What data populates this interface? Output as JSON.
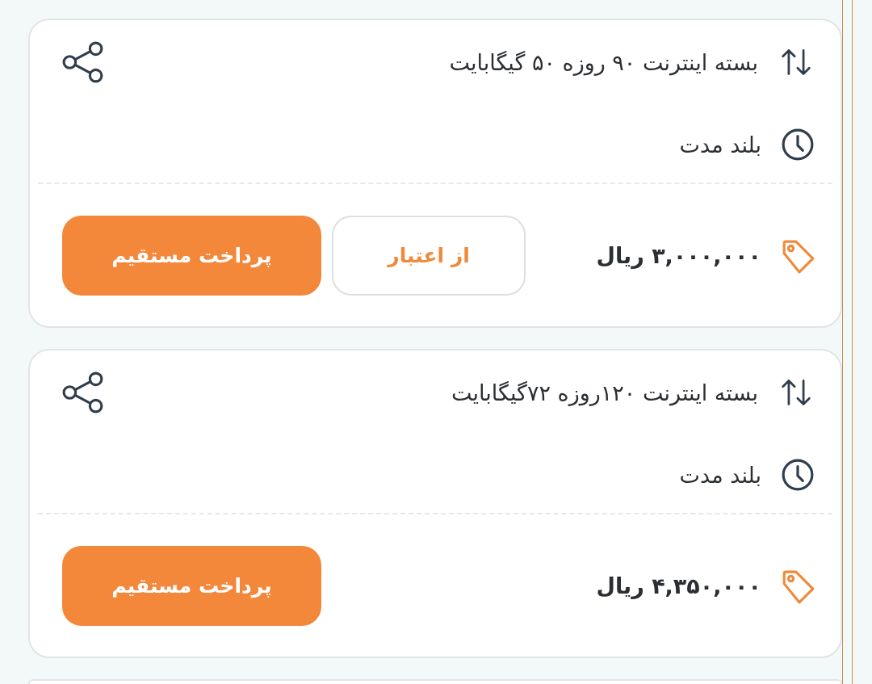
{
  "packages": [
    {
      "title": "بسته اینترنت ۹۰ روزه ۵۰ گیگابایت",
      "duration": "بلند مدت",
      "price": "۳,۰۰۰,۰۰۰ ریال",
      "buttons": [
        {
          "label": "از اعتبار",
          "kind": "outline"
        },
        {
          "label": "پرداخت مستقیم",
          "kind": "primary"
        }
      ]
    },
    {
      "title": "بسته اینترنت ۱۲۰روزه ۷۲گیگابایت",
      "duration": "بلند مدت",
      "price": "۴,۳۵۰,۰۰۰ ریال",
      "buttons": [
        {
          "label": "پرداخت مستقیم",
          "kind": "primary"
        }
      ]
    }
  ],
  "more_below": true
}
